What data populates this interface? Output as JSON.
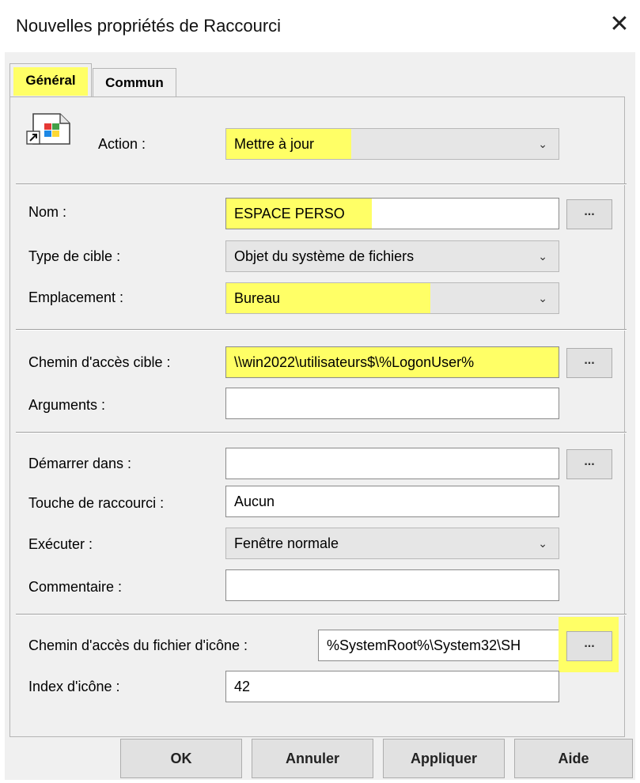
{
  "window": {
    "title": "Nouvelles propriétés de Raccourci",
    "close_glyph": "✕"
  },
  "tabs": [
    {
      "label": "Général",
      "selected": true
    },
    {
      "label": "Commun",
      "selected": false
    }
  ],
  "action": {
    "label": "Action :",
    "value": "Mettre à jour"
  },
  "nom": {
    "label": "Nom :",
    "value": "ESPACE PERSO"
  },
  "type_cible": {
    "label": "Type de cible :",
    "value": "Objet du système de fichiers"
  },
  "emplacement": {
    "label": "Emplacement :",
    "value": "Bureau"
  },
  "chemin_cible": {
    "label": "Chemin d'accès cible :",
    "value": "\\\\win2022\\utilisateurs$\\%LogonUser%"
  },
  "arguments": {
    "label": "Arguments :",
    "value": ""
  },
  "demarrer_dans": {
    "label": "Démarrer dans :",
    "value": ""
  },
  "touche_raccourci": {
    "label": "Touche de raccourci :",
    "value": "Aucun"
  },
  "executer": {
    "label": "Exécuter :",
    "value": "Fenêtre normale"
  },
  "commentaire": {
    "label": "Commentaire :",
    "value": ""
  },
  "chemin_icone": {
    "label": "Chemin d'accès du fichier d'icône :",
    "value": "%SystemRoot%\\System32\\SH"
  },
  "index_icone": {
    "label": "Index d'icône :",
    "value": "42"
  },
  "browse_label": "...",
  "buttons": {
    "ok": "OK",
    "annuler": "Annuler",
    "appliquer": "Appliquer",
    "aide": "Aide"
  },
  "colors": {
    "highlight": "#ffff66",
    "background": "#f0f0f0"
  },
  "icons": {
    "shortcut": "shortcut-file-icon",
    "dropdown": "chevron-down-icon"
  }
}
